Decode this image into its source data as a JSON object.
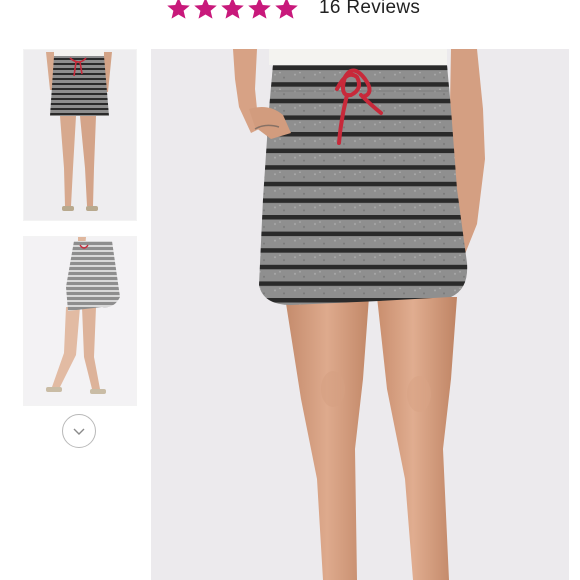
{
  "rating": {
    "stars_filled": 5,
    "stars_total": 5,
    "star_color": "#c8197b",
    "review_count_label": "16 Reviews"
  },
  "gallery": {
    "thumbnails": [
      {
        "icon": "product-front-view-thumbnail",
        "selected": true
      },
      {
        "icon": "product-side-view-thumbnail",
        "selected": false
      }
    ],
    "more_icon": "chevron-down-icon",
    "main_image_icon": "striped-skirt-product-photo"
  },
  "colors": {
    "image_background": "#eceaed",
    "stripe_gray": "#8d8d8d",
    "stripe_dark": "#2a2a2a",
    "drawstring": "#c8293a"
  }
}
